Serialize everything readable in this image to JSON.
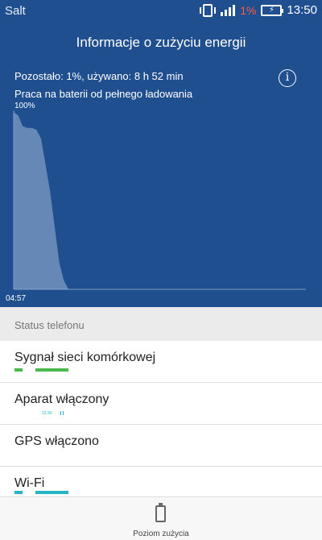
{
  "statusbar": {
    "carrier": "Salt",
    "battery_percent": "1%",
    "time": "13:50"
  },
  "header": {
    "title": "Informacje o zużyciu energii",
    "remaining": "Pozostało: 1%, używano: 8 h 52 min",
    "subtitle": "Praca na baterii od pełnego ładowania"
  },
  "chart_data": {
    "type": "area",
    "y_top_label": "100%",
    "x_start_label": "04:57",
    "ylim": [
      0,
      100
    ],
    "series": [
      {
        "values": [
          100,
          98,
          92,
          91,
          91,
          90,
          85,
          70,
          55,
          35,
          15,
          5,
          0
        ]
      }
    ]
  },
  "section": {
    "title": "Status telefonu"
  },
  "rows": [
    {
      "label": "Sygnał sieci komórkowej"
    },
    {
      "label": "Aparat włączony",
      "tiny": "12:30"
    },
    {
      "label": "GPS włączono"
    },
    {
      "label": "Wi-Fi"
    }
  ],
  "bottom": {
    "label": "Poziom zużycia"
  },
  "colors": {
    "header_bg": "#1f4f8f",
    "signal_bar": "#4db84d",
    "wifi_bar": "#26b5c4",
    "battery_low": "#ff5a4a"
  }
}
